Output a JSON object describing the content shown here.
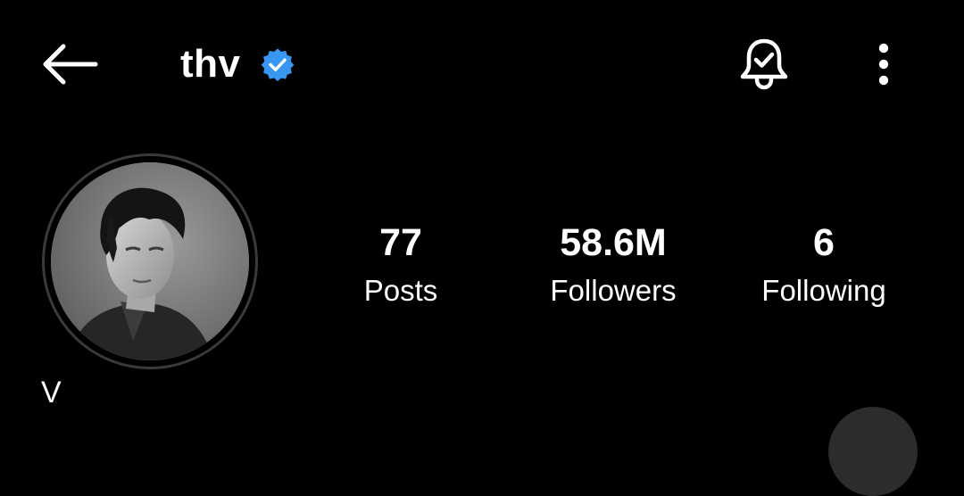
{
  "header": {
    "username": "thv",
    "verified_icon": "verified-badge-icon",
    "verified_color": "#3897f0",
    "back_icon": "arrow-left-icon",
    "notification_icon": "bell-check-icon",
    "more_icon": "more-vertical-icon"
  },
  "profile": {
    "display_name": "V",
    "avatar_icon": "profile-photo"
  },
  "stats": [
    {
      "value": "77",
      "label": "Posts"
    },
    {
      "value": "58.6M",
      "label": "Followers"
    },
    {
      "value": "6",
      "label": "Following"
    }
  ],
  "colors": {
    "background": "#000000",
    "text": "#ffffff",
    "avatar_ring": "#3a3a3a"
  }
}
